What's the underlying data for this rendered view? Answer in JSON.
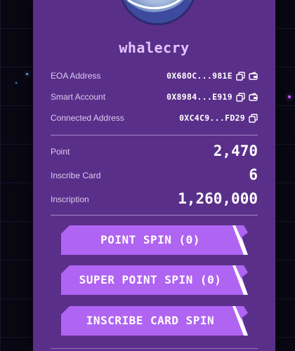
{
  "profile": {
    "username": "whalecry"
  },
  "addresses": [
    {
      "label": "EOA Address",
      "value": "0X68OC...981E",
      "has_wallet_icon": true
    },
    {
      "label": "Smart Account",
      "value": "0X8984...E919",
      "has_wallet_icon": true
    },
    {
      "label": "Connected Address",
      "value": "0XC4C9...FD29",
      "has_wallet_icon": false
    }
  ],
  "stats": [
    {
      "label": "Point",
      "value": "2,470"
    },
    {
      "label": "Inscribe Card",
      "value": "6"
    },
    {
      "label": "Inscription",
      "value": "1,260,000"
    }
  ],
  "buttons": {
    "point_spin": "POINT SPIN (0)",
    "super_point_spin": "SUPER POINT SPIN (0)",
    "inscribe_card_spin": "INSCRIBE CARD SPIN"
  },
  "icons": {
    "copy": "copy-icon",
    "wallet": "wallet-icon"
  },
  "colors": {
    "panel": "#5a2f8a",
    "button": "#b064f2",
    "username": "#e6c5ff"
  }
}
